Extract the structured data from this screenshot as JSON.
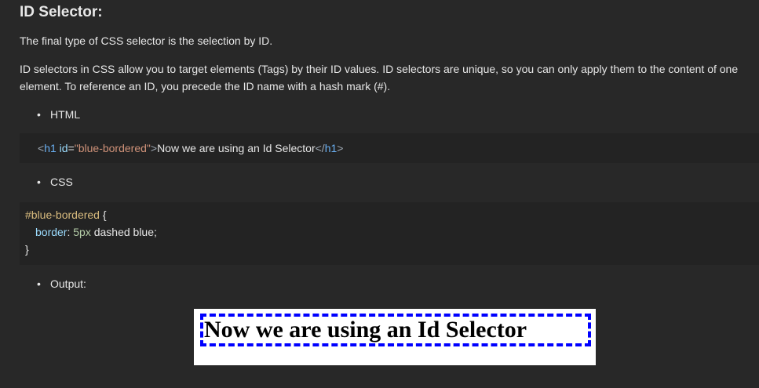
{
  "section": {
    "heading": "ID Selector:",
    "intro": "The final type of CSS selector is the selection by ID.",
    "description": "ID selectors in CSS allow you to target elements (Tags) by their ID values. ID selectors are unique, so you can only apply them to the content of one element. To reference an ID, you precede the ID name with a hash mark (#)."
  },
  "bullets": {
    "html": "HTML",
    "css": "CSS",
    "output": "Output:"
  },
  "html_code": {
    "open_lt": "<",
    "tag": "h1",
    "space": " ",
    "attr": "id",
    "eq": "=",
    "value": "\"blue-bordered\"",
    "open_gt": ">",
    "text": "Now we are using an Id Selector",
    "close_lt": "</",
    "close_tag": "h1",
    "close_gt": ">"
  },
  "css_code": {
    "selector": "#blue-bordered",
    "open_brace": " {",
    "property": "border",
    "colon": ": ",
    "number": "5px",
    "rest": " dashed blue;",
    "close_brace": "}"
  },
  "output": {
    "text": "Now we are using an Id Selector",
    "border_color": "#0000ff"
  },
  "colors": {
    "background": "#282828",
    "code_background": "#232323",
    "text": "#e6e6e6"
  }
}
